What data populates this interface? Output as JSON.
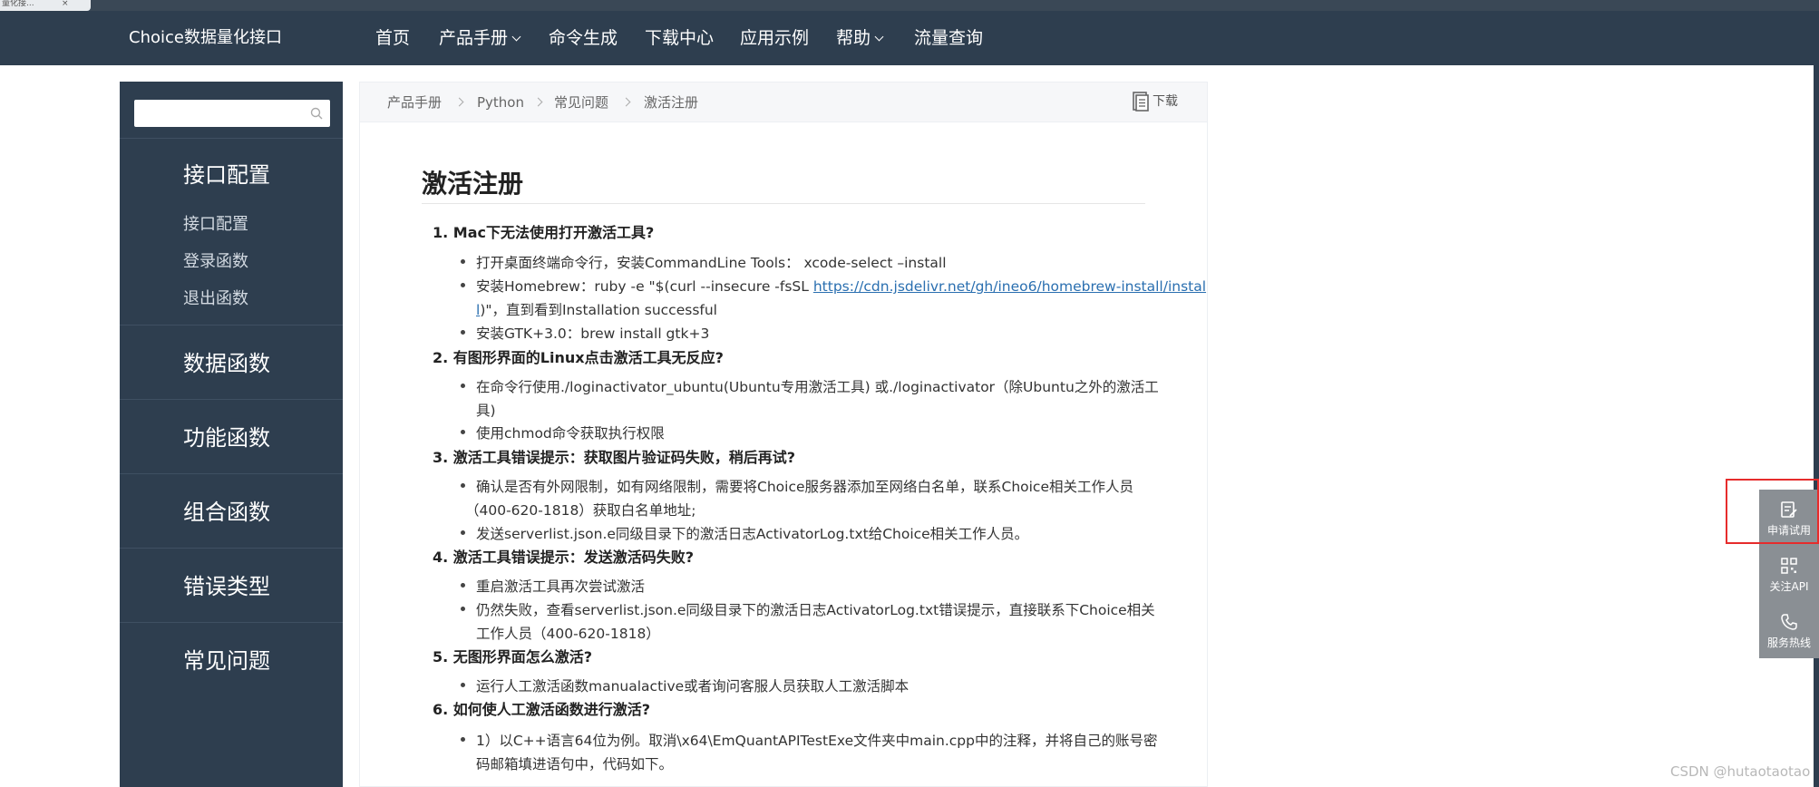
{
  "browser": {
    "tab_title": "量化接...",
    "tab_close": "×"
  },
  "navbar": {
    "brand": "Choice数据量化接口",
    "items": [
      {
        "label": "首页",
        "dropdown": false
      },
      {
        "label": "产品手册",
        "dropdown": true
      },
      {
        "label": "命令生成",
        "dropdown": false
      },
      {
        "label": "下载中心",
        "dropdown": false
      },
      {
        "label": "应用示例",
        "dropdown": false
      },
      {
        "label": "帮助",
        "dropdown": true
      },
      {
        "label": "流量查询",
        "dropdown": false
      }
    ]
  },
  "sidebar": {
    "search": {
      "value": "",
      "placeholder": "",
      "icon": "search-icon"
    },
    "sections": [
      {
        "title": "接口配置",
        "items": [
          "接口配置",
          "登录函数",
          "退出函数"
        ]
      },
      {
        "title": "数据函数",
        "items": []
      },
      {
        "title": "功能函数",
        "items": []
      },
      {
        "title": "组合函数",
        "items": []
      },
      {
        "title": "错误类型",
        "items": []
      },
      {
        "title": "常见问题",
        "items": []
      }
    ]
  },
  "breadcrumb": [
    "产品手册",
    "Python",
    "常见问题",
    "激活注册"
  ],
  "download_label": "下载",
  "article": {
    "title": "激活注册",
    "q1": "1. Mac下无法使用打开激活工具?",
    "q1_b1": "打开桌面终端命令行，安装CommandLine Tools： xcode-select –install",
    "q1_b2_pre": "安装Homebrew：ruby -e \"$(curl --insecure -fsSL ",
    "q1_b2_link": "https://cdn.jsdelivr.net/gh/ineo6/homebrew-install/instal",
    "q1_b2_link2": "l",
    "q1_b2_post": ")\"，直到看到Installation successful",
    "q1_b3": "安装GTK+3.0：brew install gtk+3",
    "q2": "2. 有图形界面的Linux点击激活工具无反应?",
    "q2_b1": "在命令行使用./loginactivator_ubuntu(Ubuntu专用激活工具) 或./loginactivator（除Ubuntu之外的激活工",
    "q2_b1_cont": "具)",
    "q2_b2": "使用chmod命令获取执行权限",
    "q3": "3. 激活工具错误提示：获取图片验证码失败，稍后再试?",
    "q3_b1": "确认是否有外网限制，如有网络限制，需要将Choice服务器添加至网络白名单，联系Choice相关工作人员",
    "q3_b1_cont": "（400-620-1818）获取白名单地址;",
    "q3_b2": "发送serverlist.json.e同级目录下的激活日志ActivatorLog.txt给Choice相关工作人员。",
    "q4": "4. 激活工具错误提示：发送激活码失败?",
    "q4_b1": "重启激活工具再次尝试激活",
    "q4_b2": "仍然失败，查看serverlist.json.e同级目录下的激活日志ActivatorLog.txt错误提示，直接联系下Choice相关",
    "q4_b2_cont": "工作人员（400-620-1818）",
    "q5": "5. 无图形界面怎么激活?",
    "q5_b1": "运行人工激活函数manualactive或者询问客服人员获取人工激活脚本",
    "q6": "6. 如何使人工激活函数进行激活?",
    "q6_b1": "1）以C++语言64位为例。取消\\x64\\EmQuantAPITestExe文件夹中main.cpp中的注释，并将自己的账号密",
    "q6_b1_cont": "码邮箱填进语句中，代码如下。"
  },
  "float_widget": {
    "items": [
      {
        "label": "申请试用",
        "icon": "apply-trial-icon"
      },
      {
        "label": "关注API",
        "icon": "qr-code-icon"
      },
      {
        "label": "服务热线",
        "icon": "phone-icon"
      }
    ],
    "highlight_color": "#e62c2c"
  },
  "watermark": "CSDN @hutaotaotao",
  "colors": {
    "nav_bg": "#2e3e4f",
    "link": "#2a6fb0"
  }
}
